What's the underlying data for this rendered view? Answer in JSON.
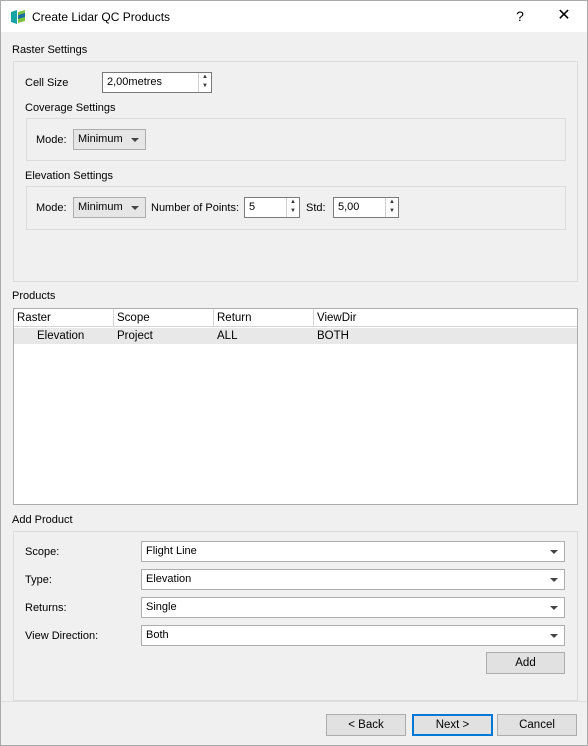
{
  "window": {
    "title": "Create Lidar QC Products",
    "help_label": "?",
    "close_label": "✕"
  },
  "raster_settings": {
    "label": "Raster Settings",
    "cell_size_label": "Cell Size",
    "cell_size_value": "2,00metres",
    "coverage": {
      "label": "Coverage Settings",
      "mode_label": "Mode:",
      "mode_value": "Minimum"
    },
    "elevation": {
      "label": "Elevation Settings",
      "mode_label": "Mode:",
      "mode_value": "Minimum",
      "points_label": "Number of Points:",
      "points_value": "5",
      "std_label": "Std:",
      "std_value": "5,00"
    }
  },
  "products": {
    "label": "Products",
    "columns": [
      "Raster",
      "Scope",
      "Return",
      "ViewDir"
    ],
    "rows": [
      {
        "raster": "Elevation",
        "scope": "Project",
        "return": "ALL",
        "viewdir": "BOTH"
      }
    ]
  },
  "add_product": {
    "label": "Add Product",
    "scope_label": "Scope:",
    "scope_value": "Flight Line",
    "type_label": "Type:",
    "type_value": "Elevation",
    "returns_label": "Returns:",
    "returns_value": "Single",
    "view_label": "View Direction:",
    "view_value": "Both",
    "add_button": "Add"
  },
  "footer": {
    "back": "< Back",
    "next": "Next >",
    "cancel": "Cancel"
  },
  "colors": {
    "accent": "#0078d7",
    "logo_teal": "#17a2a6",
    "logo_green": "#7cc242"
  }
}
